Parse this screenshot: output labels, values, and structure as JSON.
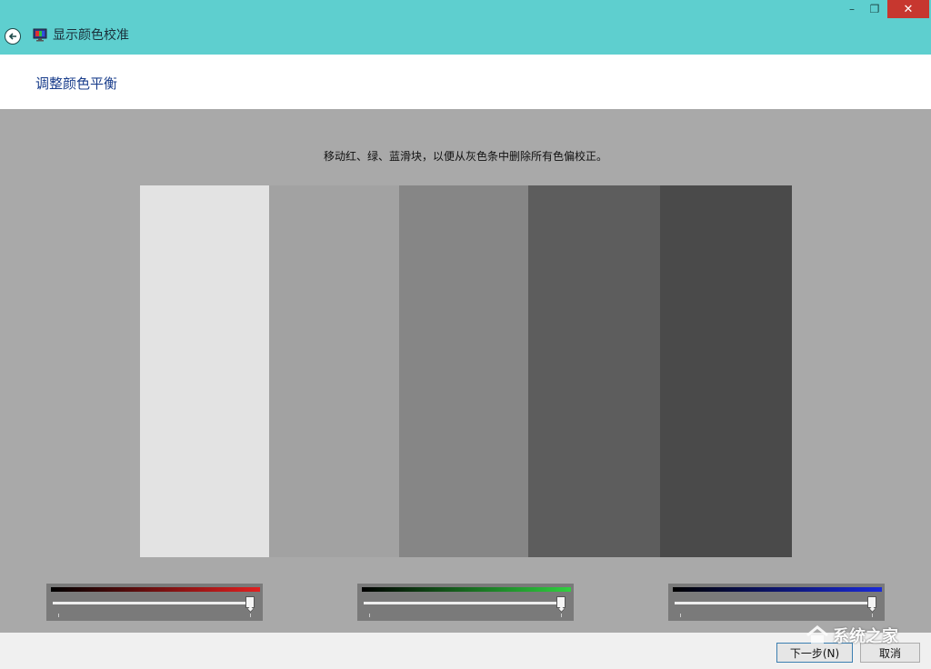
{
  "window": {
    "title": "显示颜色校准",
    "minimize": "–",
    "maximize": "❐",
    "close": "✕"
  },
  "page": {
    "title": "调整颜色平衡",
    "instruction": "移动红、绿、蓝滑块，以便从灰色条中删除所有色偏校正。"
  },
  "gray_bars": [
    {
      "name": "bar-1",
      "color": "#e3e3e3"
    },
    {
      "name": "bar-2",
      "color": "#a2a2a2"
    },
    {
      "name": "bar-3",
      "color": "#868686"
    },
    {
      "name": "bar-4",
      "color": "#5d5d5d"
    },
    {
      "name": "bar-5",
      "color": "#4a4a4a"
    }
  ],
  "sliders": [
    {
      "channel": "red",
      "color": "#e02020",
      "value": 1.0
    },
    {
      "channel": "green",
      "color": "#30d040",
      "value": 1.0
    },
    {
      "channel": "blue",
      "color": "#1a2ad8",
      "value": 1.0
    }
  ],
  "footer": {
    "next_label": "下一步(N)",
    "cancel_label": "取消"
  },
  "watermark": {
    "text": "系统之家"
  },
  "icons": {
    "back": "back-arrow-icon",
    "app": "monitor-icon"
  }
}
